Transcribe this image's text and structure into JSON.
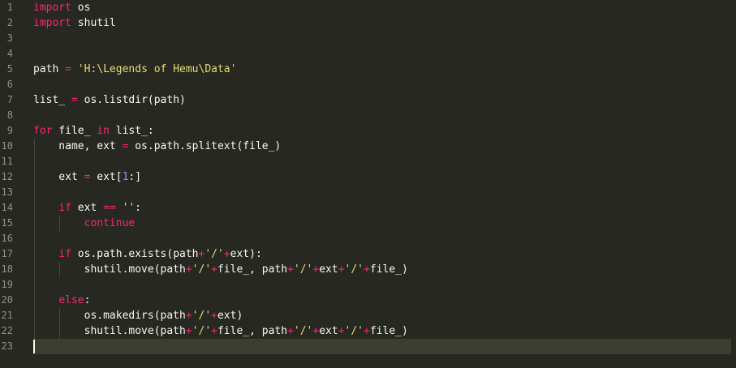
{
  "editor": {
    "theme_colors": {
      "background": "#272822",
      "active_line": "#3e3d32",
      "keyword": "#f92672",
      "string": "#e6db74",
      "number": "#ae81ff",
      "text": "#f8f8f2",
      "gutter_text": "#90908a"
    },
    "line_numbers": [
      "1",
      "2",
      "3",
      "4",
      "5",
      "6",
      "7",
      "8",
      "9",
      "10",
      "11",
      "12",
      "13",
      "14",
      "15",
      "16",
      "17",
      "18",
      "19",
      "20",
      "21",
      "22",
      "23"
    ],
    "lines": [
      {
        "tokens": [
          {
            "t": "kw",
            "v": "import"
          },
          {
            "t": "tx",
            "v": " os"
          }
        ]
      },
      {
        "tokens": [
          {
            "t": "kw",
            "v": "import"
          },
          {
            "t": "tx",
            "v": " shutil"
          }
        ]
      },
      {
        "tokens": []
      },
      {
        "tokens": []
      },
      {
        "tokens": [
          {
            "t": "tx",
            "v": "path "
          },
          {
            "t": "op",
            "v": "="
          },
          {
            "t": "tx",
            "v": " "
          },
          {
            "t": "str",
            "v": "'H:\\Legends of Hemu\\Data'"
          }
        ]
      },
      {
        "tokens": []
      },
      {
        "tokens": [
          {
            "t": "tx",
            "v": "list_ "
          },
          {
            "t": "op",
            "v": "="
          },
          {
            "t": "tx",
            "v": " os.listdir(path)"
          }
        ]
      },
      {
        "tokens": []
      },
      {
        "tokens": [
          {
            "t": "kw",
            "v": "for"
          },
          {
            "t": "tx",
            "v": " file_ "
          },
          {
            "t": "kw",
            "v": "in"
          },
          {
            "t": "tx",
            "v": " list_:"
          }
        ]
      },
      {
        "tokens": [
          {
            "t": "tx",
            "v": "    name, ext "
          },
          {
            "t": "op",
            "v": "="
          },
          {
            "t": "tx",
            "v": " os.path.splitext(file_)"
          }
        ]
      },
      {
        "tokens": []
      },
      {
        "tokens": [
          {
            "t": "tx",
            "v": "    ext "
          },
          {
            "t": "op",
            "v": "="
          },
          {
            "t": "tx",
            "v": " ext["
          },
          {
            "t": "num",
            "v": "1"
          },
          {
            "t": "tx",
            "v": ":]"
          }
        ]
      },
      {
        "tokens": []
      },
      {
        "tokens": [
          {
            "t": "tx",
            "v": "    "
          },
          {
            "t": "kw",
            "v": "if"
          },
          {
            "t": "tx",
            "v": " ext "
          },
          {
            "t": "op",
            "v": "=="
          },
          {
            "t": "tx",
            "v": " "
          },
          {
            "t": "str",
            "v": "''"
          },
          {
            "t": "tx",
            "v": ":"
          }
        ]
      },
      {
        "tokens": [
          {
            "t": "tx",
            "v": "        "
          },
          {
            "t": "kw",
            "v": "continue"
          }
        ]
      },
      {
        "tokens": []
      },
      {
        "tokens": [
          {
            "t": "tx",
            "v": "    "
          },
          {
            "t": "kw",
            "v": "if"
          },
          {
            "t": "tx",
            "v": " os.path.exists(path"
          },
          {
            "t": "op",
            "v": "+"
          },
          {
            "t": "str",
            "v": "'/'"
          },
          {
            "t": "op",
            "v": "+"
          },
          {
            "t": "tx",
            "v": "ext):"
          }
        ]
      },
      {
        "tokens": [
          {
            "t": "tx",
            "v": "        shutil.move(path"
          },
          {
            "t": "op",
            "v": "+"
          },
          {
            "t": "str",
            "v": "'/'"
          },
          {
            "t": "op",
            "v": "+"
          },
          {
            "t": "tx",
            "v": "file_, path"
          },
          {
            "t": "op",
            "v": "+"
          },
          {
            "t": "str",
            "v": "'/'"
          },
          {
            "t": "op",
            "v": "+"
          },
          {
            "t": "tx",
            "v": "ext"
          },
          {
            "t": "op",
            "v": "+"
          },
          {
            "t": "str",
            "v": "'/'"
          },
          {
            "t": "op",
            "v": "+"
          },
          {
            "t": "tx",
            "v": "file_)"
          }
        ]
      },
      {
        "tokens": []
      },
      {
        "tokens": [
          {
            "t": "tx",
            "v": "    "
          },
          {
            "t": "kw",
            "v": "else"
          },
          {
            "t": "tx",
            "v": ":"
          }
        ]
      },
      {
        "tokens": [
          {
            "t": "tx",
            "v": "        os.makedirs(path"
          },
          {
            "t": "op",
            "v": "+"
          },
          {
            "t": "str",
            "v": "'/'"
          },
          {
            "t": "op",
            "v": "+"
          },
          {
            "t": "tx",
            "v": "ext)"
          }
        ]
      },
      {
        "tokens": [
          {
            "t": "tx",
            "v": "        shutil.move(path"
          },
          {
            "t": "op",
            "v": "+"
          },
          {
            "t": "str",
            "v": "'/'"
          },
          {
            "t": "op",
            "v": "+"
          },
          {
            "t": "tx",
            "v": "file_, path"
          },
          {
            "t": "op",
            "v": "+"
          },
          {
            "t": "str",
            "v": "'/'"
          },
          {
            "t": "op",
            "v": "+"
          },
          {
            "t": "tx",
            "v": "ext"
          },
          {
            "t": "op",
            "v": "+"
          },
          {
            "t": "str",
            "v": "'/'"
          },
          {
            "t": "op",
            "v": "+"
          },
          {
            "t": "tx",
            "v": "file_)"
          }
        ]
      },
      {
        "tokens": []
      }
    ],
    "active_line_index": 22
  }
}
